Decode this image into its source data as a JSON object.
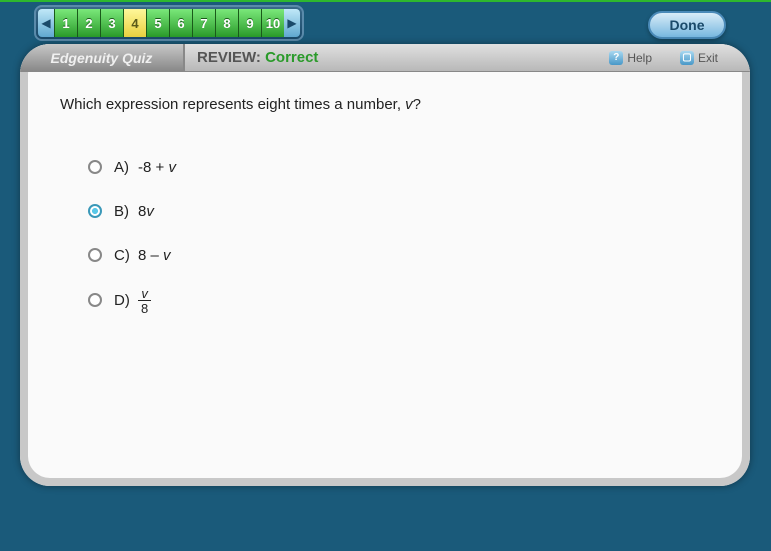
{
  "nav": {
    "numbers": [
      "1",
      "2",
      "3",
      "4",
      "5",
      "6",
      "7",
      "8",
      "9",
      "10"
    ],
    "current_index": 3
  },
  "done_label": "Done",
  "brand": "Edgenuity Quiz",
  "review": {
    "prefix": "REVIEW: ",
    "status": "Correct"
  },
  "help_label": "Help",
  "exit_label": "Exit",
  "question": {
    "prompt_before": "Which expression represents eight times a number, ",
    "prompt_var": "v",
    "prompt_after": "?"
  },
  "options": {
    "a": {
      "letter": "A)",
      "text_before": "-8 + ",
      "var": "v",
      "text_after": ""
    },
    "b": {
      "letter": "B)",
      "text_before": "8",
      "var": "v",
      "text_after": "",
      "selected": true
    },
    "c": {
      "letter": "C)",
      "text_before": "8 – ",
      "var": "v",
      "text_after": ""
    },
    "d": {
      "letter": "D)",
      "fraction_num": "v",
      "fraction_den": "8"
    }
  }
}
